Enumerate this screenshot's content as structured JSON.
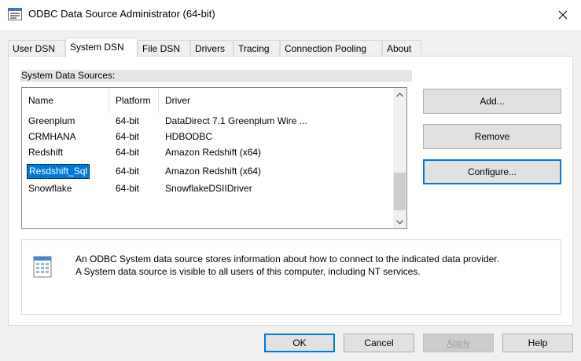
{
  "window": {
    "title": "ODBC Data Source Administrator (64-bit)"
  },
  "tabs": [
    {
      "label": "User DSN"
    },
    {
      "label": "System DSN"
    },
    {
      "label": "File DSN"
    },
    {
      "label": "Drivers"
    },
    {
      "label": "Tracing"
    },
    {
      "label": "Connection Pooling"
    },
    {
      "label": "About"
    }
  ],
  "active_tab": "System DSN",
  "system_dsn": {
    "group_label": "System Data Sources:",
    "columns": [
      "Name",
      "Platform",
      "Driver"
    ],
    "rows": [
      {
        "name": "Greenplum",
        "platform": "64-bit",
        "driver": "DataDirect 7.1 Greenplum Wire ..."
      },
      {
        "name": "CRMHANA",
        "platform": "64-bit",
        "driver": "HDBODBC"
      },
      {
        "name": "Redshift",
        "platform": "64-bit",
        "driver": "Amazon Redshift (x64)"
      },
      {
        "name": "Resdshift_Sql",
        "platform": "64-bit",
        "driver": "Amazon Redshift (x64)"
      },
      {
        "name": "Snowflake",
        "platform": "64-bit",
        "driver": "SnowflakeDSIIDriver"
      }
    ],
    "selected_row": "Resdshift_Sql",
    "buttons": {
      "add": "Add...",
      "remove": "Remove",
      "configure": "Configure..."
    },
    "info": {
      "line1": "An ODBC System data source stores information about how to connect to the indicated data provider.",
      "line2": "A System data source is visible to all users of this computer, including NT services."
    }
  },
  "dialog_buttons": {
    "ok": "OK",
    "cancel": "Cancel",
    "apply": "Apply",
    "help": "Help"
  },
  "icons": {
    "window": "odbc-app-icon",
    "close": "close-icon",
    "scroll_up": "chevron-up-icon",
    "scroll_down": "chevron-down-icon",
    "info": "data-source-icon"
  },
  "colors": {
    "selection": "#0078d7",
    "default_button_border": "#0078d7"
  }
}
